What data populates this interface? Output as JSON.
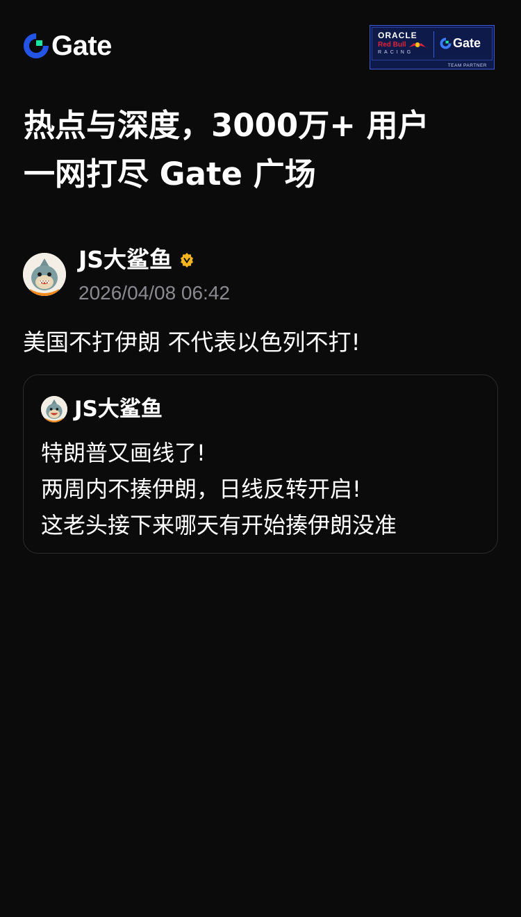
{
  "header": {
    "logo_text": "Gate",
    "partner_badge": {
      "line1": "ORACLE",
      "line2": "Red Bull",
      "line3": "RACING",
      "brand": "Gate",
      "footer": "TEAM PARTNER"
    }
  },
  "headline": {
    "line1": "热点与深度，3000万+ 用户",
    "line2": "一网打尽 Gate 广场"
  },
  "post": {
    "author": "JS大鲨鱼",
    "verified_icon": "verified-badge-icon",
    "timestamp": "2026/04/08 06:42",
    "text": "美国不打伊朗 不代表以色列不打!",
    "quote": {
      "author": "JS大鲨鱼",
      "lines": [
        "特朗普又画线了!",
        "两周内不揍伊朗，日线反转开启!",
        "这老头接下来哪天有开始揍伊朗没准"
      ]
    }
  },
  "colors": {
    "background": "#0b0b0c",
    "text_primary": "#ffffff",
    "text_secondary": "#8a8a8f",
    "brand_blue": "#2354e6",
    "brand_green": "#17e5a1",
    "verified_gold": "#f5b51c",
    "card_border": "#2c2c30"
  }
}
